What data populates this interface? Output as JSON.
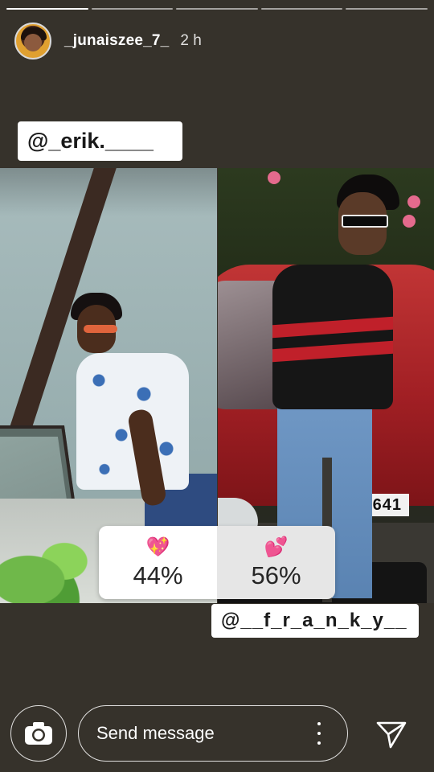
{
  "progress": {
    "segments": 5,
    "active_index": 0
  },
  "header": {
    "username": "_junaiszee_7_",
    "time": "2 h"
  },
  "stickers": {
    "mention_top": "@_erik.____",
    "mention_bottom": "@__f_r_a_n_k_y__"
  },
  "poll": {
    "options": [
      {
        "emoji": "💖",
        "percent": "44%"
      },
      {
        "emoji": "💕",
        "percent": "56%"
      }
    ]
  },
  "photo": {
    "plate_text": "KL 1   3641"
  },
  "bottom_bar": {
    "message_placeholder": "Send message"
  },
  "colors": {
    "background": "#36322b",
    "poll_a": "#ffffff",
    "poll_b": "#e6e6e6"
  }
}
